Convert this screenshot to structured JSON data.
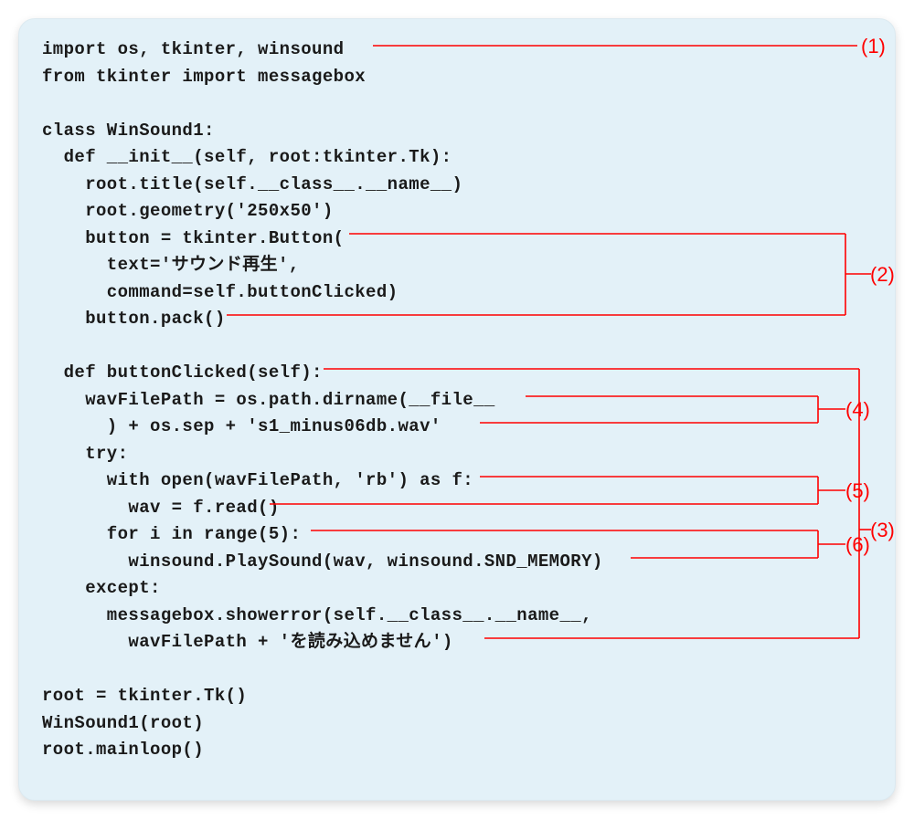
{
  "code": {
    "l1": "import os, tkinter, winsound",
    "l2": "from tkinter import messagebox",
    "l3": "",
    "l4": "class WinSound1:",
    "l5": "  def __init__(self, root:tkinter.Tk):",
    "l6": "    root.title(self.__class__.__name__)",
    "l7": "    root.geometry('250x50')",
    "l8": "    button = tkinter.Button(",
    "l9": "      text='サウンド再生',",
    "l10": "      command=self.buttonClicked)",
    "l11": "    button.pack()",
    "l12": "",
    "l13": "  def buttonClicked(self):",
    "l14": "    wavFilePath = os.path.dirname(__file__",
    "l15": "      ) + os.sep + 's1_minus06db.wav'",
    "l16": "    try:",
    "l17": "      with open(wavFilePath, 'rb') as f:",
    "l18": "        wav = f.read()",
    "l19": "      for i in range(5):",
    "l20": "        winsound.PlaySound(wav, winsound.SND_MEMORY)",
    "l21": "    except:",
    "l22": "      messagebox.showerror(self.__class__.__name__,",
    "l23": "        wavFilePath + 'を読み込めません')",
    "l24": "",
    "l25": "root = tkinter.Tk()",
    "l26": "WinSound1(root)",
    "l27": "root.mainloop()"
  },
  "annotations": {
    "a1": "(1)",
    "a2": "(2)",
    "a3": "(3)",
    "a4": "(4)",
    "a5": "(5)",
    "a6": "(6)"
  }
}
